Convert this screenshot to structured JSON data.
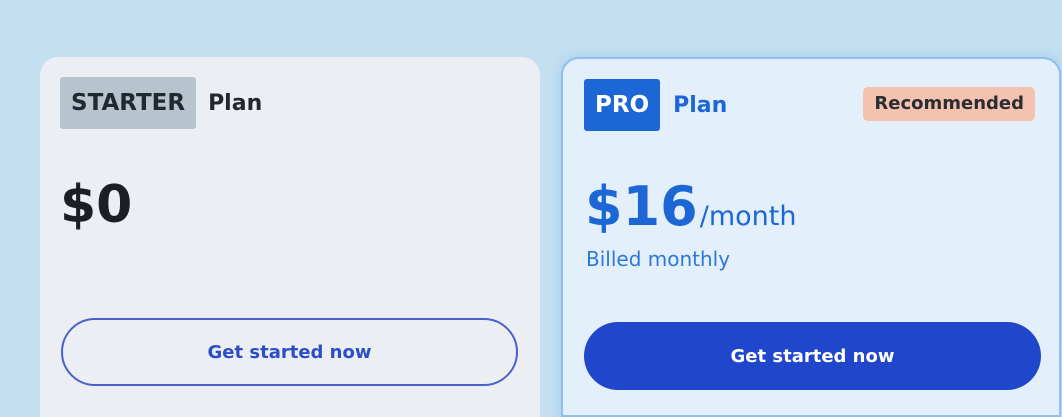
{
  "plans": {
    "starter": {
      "tier": "STARTER",
      "plan_label": "Plan",
      "price": "$0",
      "cta_label": "Get started now"
    },
    "pro": {
      "tier": "PRO",
      "plan_label": "Plan",
      "badge": "Recommended",
      "price": "$16",
      "period": "/month",
      "billing_note": "Billed monthly",
      "cta_label": "Get started now"
    }
  },
  "colors": {
    "page_background": "#c3dff0",
    "starter_card": "#ebeff3",
    "pro_card": "#e3f0fc",
    "pro_accent": "#1d66d6",
    "cta_primary": "#2046cc",
    "recommended_badge": "#f4c2ae"
  }
}
